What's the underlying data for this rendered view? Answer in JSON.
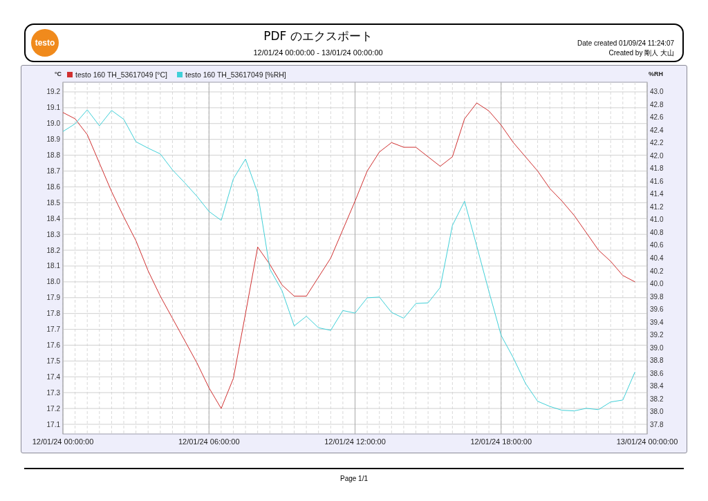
{
  "header": {
    "logo": "testo",
    "title": "PDF のエクスポート",
    "date_range": "12/01/24 00:00:00 - 13/01/24 00:00:00",
    "date_created": "Date created 01/09/24 11:24:07",
    "created_by": "Created by 剛人 大山"
  },
  "chart": {
    "chart_data": {
      "type": "line",
      "grid": true,
      "legend": "top",
      "ylabel": "°C",
      "y2label": "%RH",
      "ylim": [
        17.039,
        19.261
      ],
      "y2lim": [
        37.649,
        43.151
      ],
      "categories": [
        "12/01/24 00:00:00",
        null,
        null,
        null,
        null,
        null,
        null,
        null,
        null,
        null,
        null,
        null,
        "12/01/24 06:00:00",
        null,
        null,
        null,
        null,
        null,
        null,
        null,
        null,
        null,
        null,
        null,
        "12/01/24 12:00:00",
        null,
        null,
        null,
        null,
        null,
        null,
        null,
        null,
        null,
        null,
        null,
        "12/01/24 18:00:00",
        null,
        null,
        null,
        null,
        null,
        null,
        null,
        null,
        null,
        null,
        null,
        "13/01/24 00:00:00"
      ],
      "yticks": [
        17.1,
        17.2,
        17.3,
        17.4,
        17.5,
        17.6,
        17.7,
        17.8,
        17.9,
        {
          "value": 18,
          "label": "18.0"
        },
        18.1,
        18.2,
        18.3,
        18.4,
        18.5,
        18.6,
        18.7,
        18.8,
        18.9,
        {
          "value": 19,
          "label": "19.0"
        },
        19.1,
        19.2
      ],
      "y2ticks": [
        37.8,
        {
          "value": 38,
          "label": "38.0"
        },
        38.2,
        38.4,
        38.6,
        38.8,
        {
          "value": 39,
          "label": "39.0"
        },
        39.2,
        39.4,
        39.6,
        39.8,
        {
          "value": 40,
          "label": "40.0"
        },
        40.2,
        40.4,
        40.6,
        40.8,
        {
          "value": 41,
          "label": "41.0"
        },
        41.2,
        41.4,
        41.6,
        41.8,
        {
          "value": 42,
          "label": "42.0"
        },
        42.2,
        42.4,
        42.6,
        42.8,
        {
          "value": 43,
          "label": "43.0"
        }
      ],
      "series": [
        {
          "name": "testo 160 TH_53617049 [°C]",
          "color": "#d03030",
          "axis": "y",
          "values": [
            19.07,
            19.03,
            18.93,
            18.75,
            18.57,
            18.41,
            18.26,
            18.07,
            17.91,
            17.77,
            17.63,
            17.49,
            17.33,
            17.2,
            17.39,
            17.8,
            18.22,
            18.11,
            17.98,
            17.91,
            17.91,
            18.03,
            18.15,
            18.33,
            18.51,
            18.7,
            18.82,
            18.88,
            18.85,
            18.85,
            18.79,
            18.73,
            18.79,
            19.03,
            19.13,
            19.08,
            18.99,
            18.88,
            18.79,
            18.7,
            18.59,
            18.51,
            18.42,
            18.31,
            18.2,
            18.13,
            18.04,
            18.0,
            null
          ]
        },
        {
          "name": "testo 160 TH_53617049 [%RH]",
          "color": "#40d0d8",
          "axis": "y2",
          "values": [
            42.38,
            42.5,
            42.72,
            42.47,
            42.71,
            42.57,
            42.22,
            42.12,
            42.03,
            41.78,
            41.58,
            41.37,
            41.13,
            40.99,
            41.64,
            41.95,
            41.42,
            40.23,
            39.89,
            39.34,
            39.49,
            39.31,
            39.27,
            39.58,
            39.54,
            39.78,
            39.79,
            39.55,
            39.46,
            39.69,
            39.7,
            39.94,
            40.91,
            41.29,
            40.59,
            39.88,
            39.19,
            38.84,
            38.44,
            38.16,
            38.08,
            38.02,
            38.01,
            38.05,
            38.03,
            38.15,
            38.18,
            38.62,
            null
          ]
        }
      ]
    }
  },
  "footer": {
    "page": "Page 1/1"
  }
}
